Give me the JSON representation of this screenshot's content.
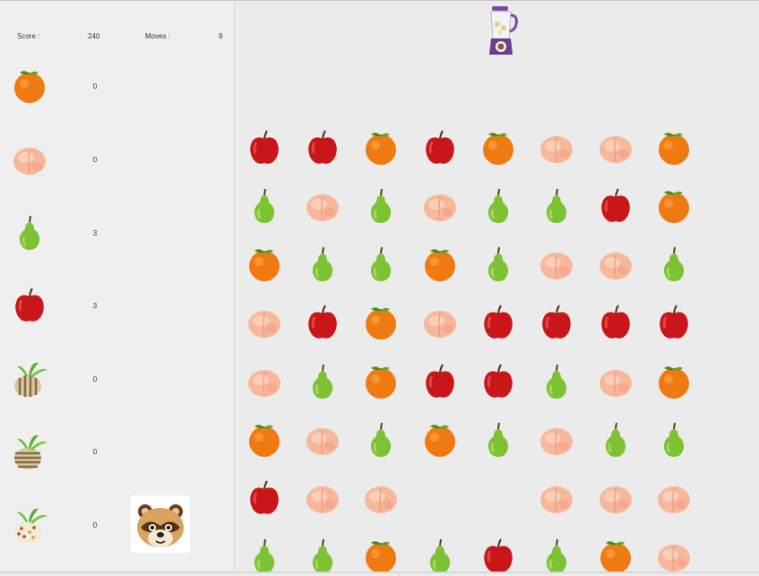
{
  "hud": {
    "score_label": "Score :",
    "score_value": "240",
    "moves_label": "Moves :",
    "moves_value": "9"
  },
  "inventory": [
    {
      "item": "orange",
      "count": "0"
    },
    {
      "item": "peach",
      "count": "0"
    },
    {
      "item": "pear",
      "count": "3"
    },
    {
      "item": "apple",
      "count": "3"
    },
    {
      "item": "turnip-striped-vertical",
      "count": "0"
    },
    {
      "item": "turnip-striped-horizontal",
      "count": "0"
    },
    {
      "item": "turnip-spotted",
      "count": "0"
    }
  ],
  "board": {
    "rows": [
      [
        "apple",
        "apple",
        "orange",
        "apple",
        "orange",
        "peach",
        "peach",
        "orange"
      ],
      [
        "pear",
        "peach",
        "pear",
        "peach",
        "pear",
        "pear",
        "apple",
        "orange"
      ],
      [
        "orange",
        "pear",
        "pear",
        "orange",
        "pear",
        "peach",
        "peach",
        "pear"
      ],
      [
        "peach",
        "apple",
        "orange",
        "peach",
        "apple",
        "apple",
        "apple",
        "apple"
      ],
      [
        "peach",
        "pear",
        "orange",
        "apple",
        "apple",
        "pear",
        "peach",
        "orange"
      ],
      [
        "orange",
        "peach",
        "pear",
        "orange",
        "pear",
        "peach",
        "pear",
        "pear"
      ],
      [
        "apple",
        "peach",
        "peach",
        "",
        "",
        "peach",
        "peach",
        "peach"
      ],
      [
        "pear",
        "pear",
        "orange",
        "pear",
        "apple",
        "pear",
        "orange",
        "peach"
      ]
    ]
  },
  "icons": {
    "blender": "blender-icon",
    "character": "raccoon-shopkeeper-portrait"
  },
  "colors": {
    "apple": "#c8161a",
    "orange": "#f07a12",
    "pear": "#7cc232",
    "peach": "#f7b79a",
    "background": "#ededed"
  }
}
